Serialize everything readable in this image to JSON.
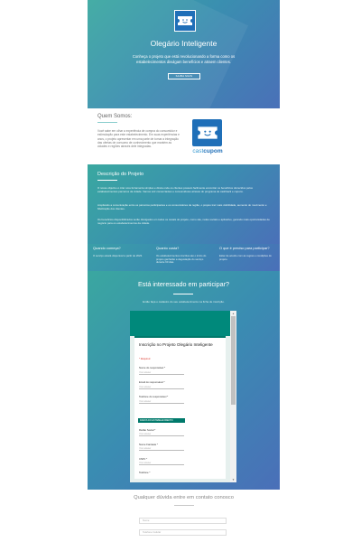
{
  "hero": {
    "title": "Olegário Inteligente",
    "line1": "Conheça o projeto que está revolucionando a forma como os",
    "line2": "estabelecimentos divulgam benefícios e atraem clientes.",
    "button": "SAIBA MAIS",
    "logo_icon": "ticket-smile-icon"
  },
  "about": {
    "heading": "Quem Somos:",
    "text": "Você sabe em olhar a experiência de compra do consumidor e estimulação para este estabelecimento. Em suas experiências e anos, o projeto apresentar em uma parte de tornar a integração das ofertas de consumo de conhecimento que mantém as cidades e regiões através dele integradas.",
    "brand_left": "cast",
    "brand_right": "cupom",
    "logo_icon": "ticket-smile-icon"
  },
  "description": {
    "heading": "Descrição do Projeto",
    "p1": "O nosso objetivo é criar uma ferramenta simples e direta onde os clientes possam facilmente encontrar os benefícios oferecidos pelos estabelecimentos parceiros da cidade. Vamos unir comerciantes e consumidores através do programa de cashback e cupons.",
    "p2": "Ampliando a comunicação entre os parceiros participantes e os consumidores da região, o projeto traz mais visibilidade, aumento do movimento e fidelização dos clientes.",
    "p3": "Os benefícios disponibilizados serão divulgados em todos os canais do projeto, como site, redes sociais e aplicativo, gerando mais oportunidades de negócio para os estabelecimentos da cidade."
  },
  "faq": [
    {
      "q": "Quando começa?",
      "a": "O serviço estará disponível a partir de 2023."
    },
    {
      "q": "Quanto custa?",
      "a": "Os estabelecimentos inscritos até o início do projeto ganharão a degustação do serviço durante 60 dias."
    },
    {
      "q": "O que é preciso para participar?",
      "a": "Estar de acordo com as regras e condições do projeto."
    }
  ],
  "form_section": {
    "heading": "Está interessado em participar?",
    "subtitle": "Então faça o cadastro do seu estabelecimento na ficha de inscrição.",
    "form_title": "Inscrição no Projeto Olegário Inteligente",
    "required_note": "* Required",
    "fields": [
      {
        "label": "Nome do responsável *",
        "placeholder": "Your answer"
      },
      {
        "label": "Email do responsável *",
        "placeholder": "Your answer"
      },
      {
        "label": "Telefone do responsável *",
        "placeholder": "Your answer"
      }
    ],
    "section_label": "DADOS DO ESTABELECIMENTO",
    "fields2": [
      {
        "label": "Razão Social *",
        "placeholder": "Your answer"
      },
      {
        "label": "Nome Fantasia *",
        "placeholder": "Your answer"
      },
      {
        "label": "CNPJ *",
        "placeholder": "Your answer"
      },
      {
        "label": "Telefone *",
        "placeholder": "Your answer"
      }
    ]
  },
  "contact": {
    "heading": "Qualquer dúvida entre em contato conosco",
    "inputs": [
      "Nome",
      "Telefone Celular"
    ]
  },
  "colors": {
    "accent": "#1f6fb8",
    "teal": "#00897b"
  }
}
